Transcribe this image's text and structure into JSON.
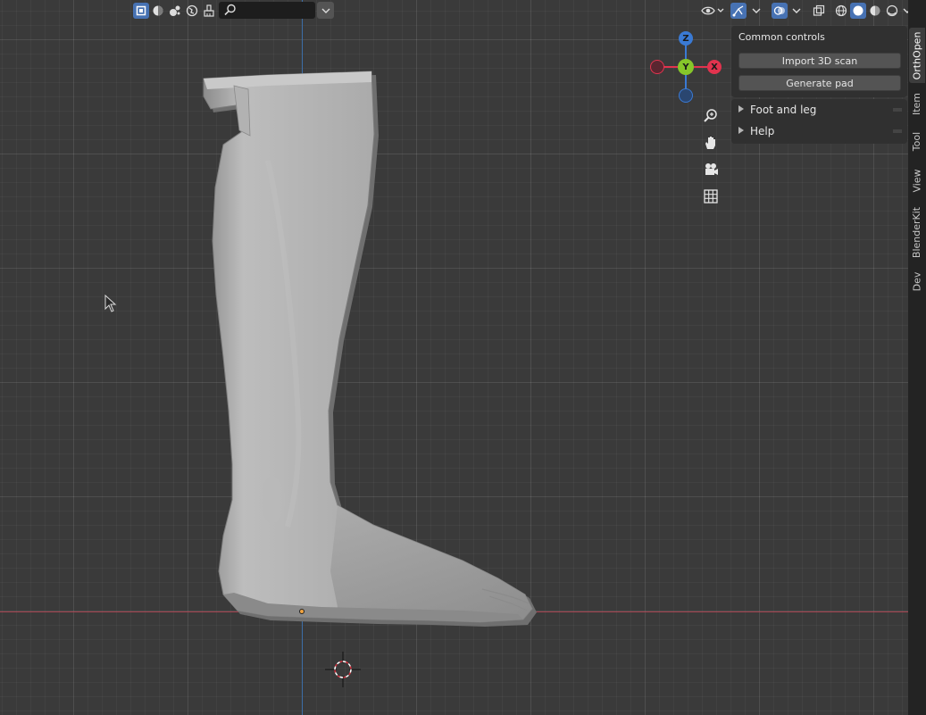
{
  "header": {
    "mode_buttons": [
      {
        "icon": "object-mode-icon",
        "active": true
      },
      {
        "icon": "solid-shading-icon",
        "active": false
      },
      {
        "icon": "particles-icon",
        "active": false
      },
      {
        "icon": "world-icon",
        "active": false
      },
      {
        "icon": "paint-brush-icon",
        "active": false
      }
    ],
    "search": {
      "value": "",
      "placeholder": ""
    },
    "right_icons": [
      "visibility-eye-icon",
      "gizmo-toggle-icon",
      "overlays-icon",
      "xray-icon",
      "wireframe-shading-icon",
      "solid-shading-icon",
      "material-shading-icon",
      "rendered-shading-icon"
    ]
  },
  "gizmo": {
    "z_label": "Z",
    "y_label": "Y",
    "x_label": "X",
    "colors": {
      "x": "#e2334e",
      "y": "#86c62a",
      "z": "#3a7ad4"
    }
  },
  "nav_buttons": [
    "zoom-icon",
    "pan-hand-icon",
    "camera-view-icon",
    "ortho-grid-icon"
  ],
  "npanel": {
    "common_controls": {
      "title": "Common controls",
      "buttons": [
        "Import 3D scan",
        "Generate pad"
      ]
    },
    "subpanels": [
      "Foot and leg",
      "Help"
    ]
  },
  "tabs": [
    {
      "label": "OrthOpen",
      "active": true
    },
    {
      "label": "Item",
      "active": false
    },
    {
      "label": "Tool",
      "active": false
    },
    {
      "label": "View",
      "active": false
    },
    {
      "label": "BlenderKit",
      "active": false
    },
    {
      "label": "Dev",
      "active": false
    }
  ],
  "colors": {
    "viewport_bg": "#3a3a3a",
    "accent": "#4772b3",
    "axis_x_line": "#a5414f",
    "axis_z_line": "#3c6ea8"
  }
}
